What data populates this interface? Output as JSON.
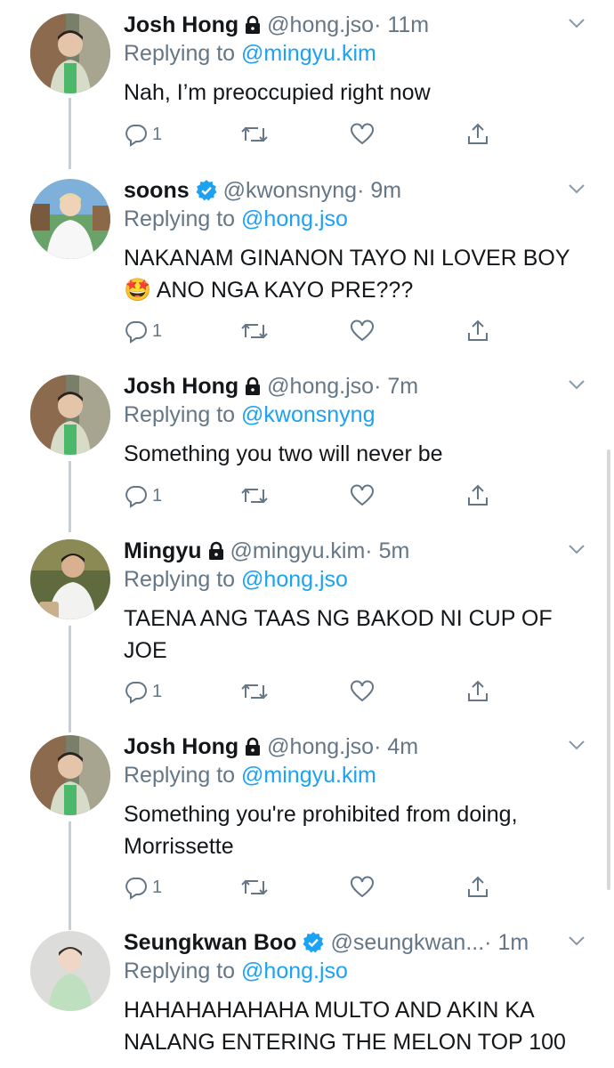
{
  "tweets": [
    {
      "name": "Josh Hong",
      "badge": "lock",
      "handle": "@hong.jso",
      "time": "· 11m",
      "replying_label": "Replying to",
      "replying_to": "@mingyu.kim",
      "lines": [
        "Nah, I’m preoccupied right now"
      ],
      "reply_count": "1"
    },
    {
      "name": "soons",
      "badge": "verified",
      "handle": "@kwonsnyng",
      "time": "· 9m",
      "replying_label": "Replying to",
      "replying_to": "@hong.jso",
      "lines": [
        "NAKANAM GINANON TAYO NI LOVER BOY",
        "🤩 ANO NGA KAYO PRE???"
      ],
      "reply_count": "1"
    },
    {
      "name": "Josh Hong",
      "badge": "lock",
      "handle": "@hong.jso",
      "time": "· 7m",
      "replying_label": "Replying to",
      "replying_to": "@kwonsnyng",
      "lines": [
        "Something you two will never be"
      ],
      "reply_count": "1"
    },
    {
      "name": "Mingyu",
      "badge": "lock",
      "handle": "@mingyu.kim",
      "time": "· 5m",
      "replying_label": "Replying to",
      "replying_to": "@hong.jso",
      "lines": [
        "TAENA ANG TAAS NG BAKOD NI CUP OF",
        "JOE"
      ],
      "reply_count": "1"
    },
    {
      "name": "Josh Hong",
      "badge": "lock",
      "handle": "@hong.jso",
      "time": "· 4m",
      "replying_label": "Replying to",
      "replying_to": "@mingyu.kim",
      "lines": [
        "Something you're prohibited from doing,",
        "Morrissette"
      ],
      "reply_count": "1"
    },
    {
      "name": "Seungkwan Boo",
      "badge": "verified",
      "handle": "@seungkwan...",
      "time": " · 1m",
      "replying_label": "Replying to",
      "replying_to": "@hong.jso",
      "lines": [
        "HAHAHAHAHAHA MULTO AND AKIN KA",
        "NALANG ENTERING THE MELON TOP 100"
      ],
      "reply_count": ""
    }
  ],
  "colors": {
    "link": "#1da1f2",
    "muted": "#657786",
    "text": "#14171a",
    "thread_line": "#c4cfd6",
    "verified": "#1da1f2"
  },
  "icons": {
    "reply": "reply-icon",
    "retweet": "retweet-icon",
    "like": "heart-icon",
    "share": "share-icon",
    "lock": "lock-icon",
    "verified": "verified-icon",
    "more": "chevron-down-icon"
  }
}
